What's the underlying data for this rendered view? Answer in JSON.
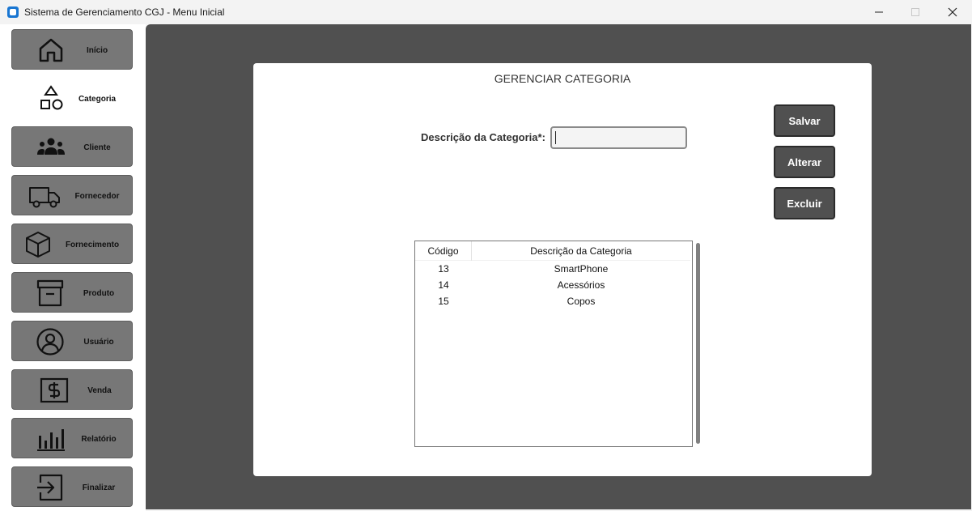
{
  "window": {
    "title": "Sistema de Gerenciamento CGJ - Menu Inicial"
  },
  "sidebar": {
    "items": [
      {
        "label": "Início",
        "icon": "home-icon",
        "active": false
      },
      {
        "label": "Categoria",
        "icon": "shapes-icon",
        "active": true
      },
      {
        "label": "Cliente",
        "icon": "users-icon",
        "active": false
      },
      {
        "label": "Fornecedor",
        "icon": "truck-icon",
        "active": false
      },
      {
        "label": "Fornecimento",
        "icon": "box-icon",
        "active": false
      },
      {
        "label": "Produto",
        "icon": "archive-icon",
        "active": false
      },
      {
        "label": "Usuário",
        "icon": "user-circle-icon",
        "active": false
      },
      {
        "label": "Venda",
        "icon": "dollar-icon",
        "active": false
      },
      {
        "label": "Relatório",
        "icon": "bar-chart-icon",
        "active": false
      },
      {
        "label": "Finalizar",
        "icon": "exit-icon",
        "active": false
      }
    ]
  },
  "panel": {
    "title": "GERENCIAR CATEGORIA",
    "field_label": "Descrição da Categoria*:",
    "field_value": "",
    "buttons": {
      "save": "Salvar",
      "edit": "Alterar",
      "delete": "Excluir"
    },
    "table": {
      "columns": [
        "Código",
        "Descrição da Categoria"
      ],
      "rows": [
        [
          "13",
          "SmartPhone"
        ],
        [
          "14",
          "Acessórios"
        ],
        [
          "15",
          "Copos"
        ]
      ]
    }
  },
  "colors": {
    "sidebar_button": "#777777",
    "main_background": "#505050",
    "action_button": "#505050",
    "accent": "#1976d2"
  }
}
